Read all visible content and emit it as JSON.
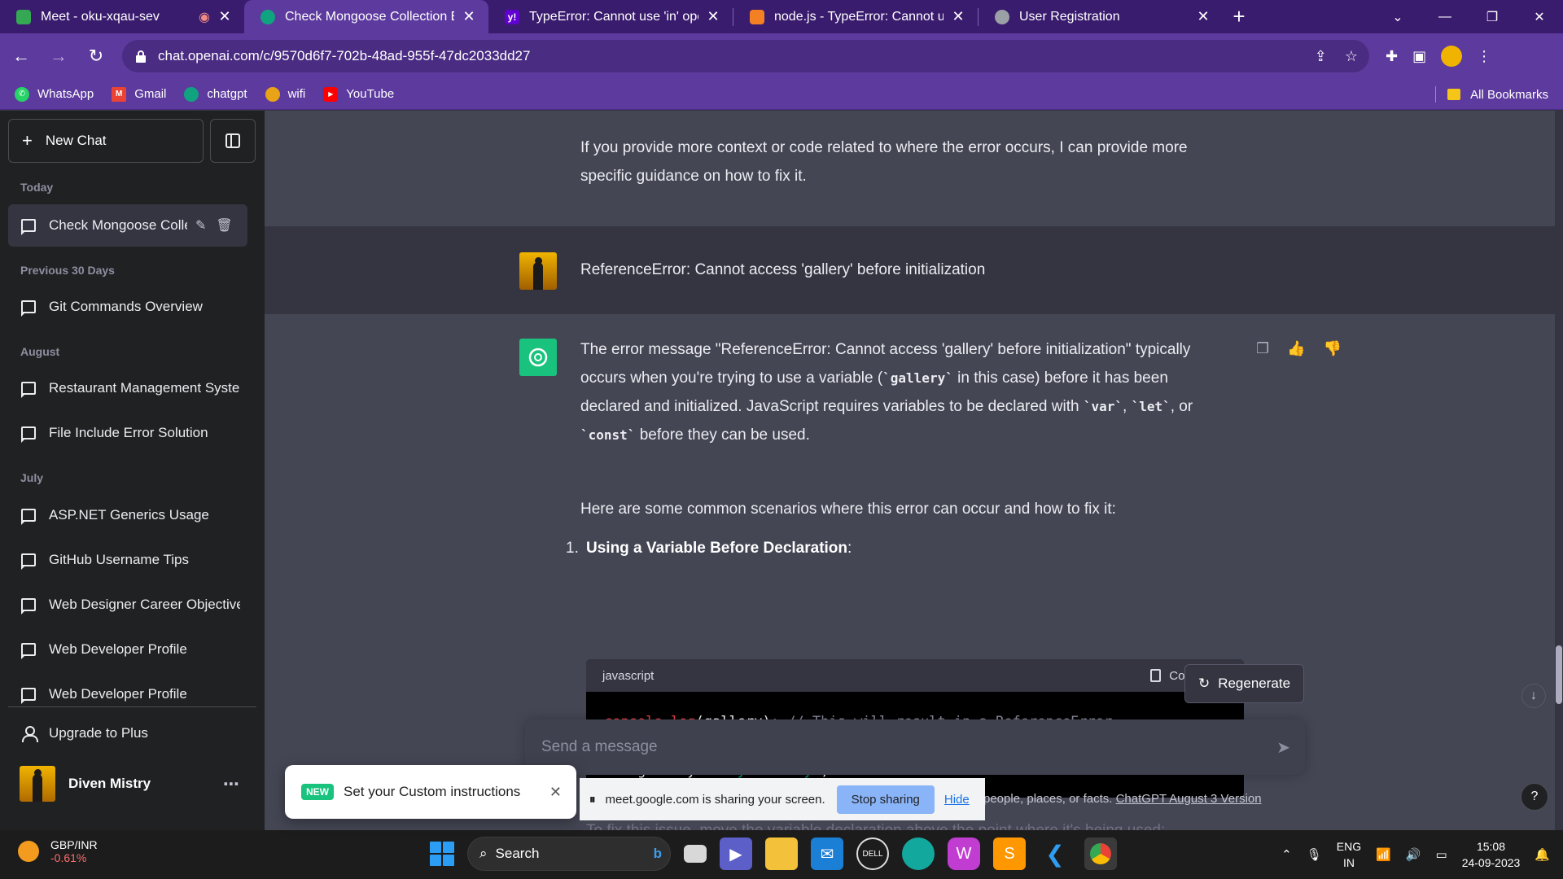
{
  "browser": {
    "tabs": [
      {
        "title": "Meet - oku-xqau-sev",
        "favicon_color": "#34a853",
        "active": false
      },
      {
        "title": "Check Mongoose Collection Exist",
        "favicon_color": "#10a37f",
        "active": true
      },
      {
        "title": "TypeError: Cannot use 'in' operat",
        "favicon_color": "#6001d2",
        "active": false
      },
      {
        "title": "node.js - TypeError: Cannot use 'i",
        "favicon_color": "#f48024",
        "active": false
      },
      {
        "title": "User Registration",
        "favicon_color": "#9aa0a6",
        "active": false
      }
    ],
    "url": "chat.openai.com/c/9570d6f7-702b-48ad-955f-47dc2033dd27",
    "bookmarks": [
      {
        "label": "WhatsApp",
        "color": "#25d366"
      },
      {
        "label": "Gmail",
        "color": "#ea4335"
      },
      {
        "label": "chatgpt",
        "color": "#10a37f"
      },
      {
        "label": "wifi",
        "color": "#e8a317"
      },
      {
        "label": "YouTube",
        "color": "#ff0000"
      }
    ],
    "all_bookmarks": "All Bookmarks"
  },
  "sidebar": {
    "new_chat": "New Chat",
    "groups": {
      "today": "Today",
      "prev30": "Previous 30 Days",
      "august": "August",
      "july": "July"
    },
    "items": [
      {
        "label": "Check Mongoose Collection Exists"
      },
      {
        "label": "Git Commands Overview"
      },
      {
        "label": "Restaurant Management System"
      },
      {
        "label": "File Include Error Solution"
      },
      {
        "label": "ASP.NET Generics Usage"
      },
      {
        "label": "GitHub Username Tips"
      },
      {
        "label": "Web Designer Career Objective"
      },
      {
        "label": "Web Developer Profile"
      },
      {
        "label": "Web Developer Profile"
      }
    ],
    "upgrade": "Upgrade to Plus",
    "user_name": "Diven Mistry"
  },
  "chat": {
    "prev_reply": "If you provide more context or code related to where the error occurs, I can provide more specific guidance on how to fix it.",
    "user_msg": "ReferenceError: Cannot access 'gallery' before initialization",
    "answer": {
      "p1_a": "The error message \"ReferenceError: Cannot access 'gallery' before initialization\" typically occurs when you're trying to use a variable (",
      "p1_code1": "`gallery`",
      "p1_b": " in this case) before it has been declared and initialized. JavaScript requires variables to be declared with ",
      "p1_code2": "`var`",
      "p1_c": ", ",
      "p1_code3": "`let`",
      "p1_d": ", or ",
      "p1_code4": "`const`",
      "p1_e": " before they can be used.",
      "p2": "Here are some common scenarios where this error can occur and how to fix it:",
      "list_num": "1.",
      "list_title": "Using a Variable Before Declaration",
      "list_colon": ":",
      "code_lang": "javascript",
      "copy_code": "Copy code",
      "code": {
        "l1_fn": "console.log",
        "l1_arg": "(gallery); ",
        "l1_cmt": "// This will result in a ReferenceError",
        "l2_kw": "let",
        "l2_mid": " gallery = ",
        "l2_str": "\"My Gallery\"",
        "l2_end": ";"
      },
      "faded": "To fix this issue, move the variable declaration above the point where it's being used:"
    },
    "regenerate": "Regenerate",
    "input_placeholder": "Send a message",
    "footer_text": "people, places, or facts. ",
    "footer_link": "ChatGPT August 3 Version"
  },
  "overlays": {
    "new_badge": "NEW",
    "custom_instructions": "Set your Custom instructions",
    "share_msg": "meet.google.com is sharing your screen.",
    "stop_sharing": "Stop sharing",
    "hide": "Hide"
  },
  "taskbar": {
    "ticker_name": "GBP/INR",
    "ticker_change": "-0.61%",
    "search": "Search",
    "lang_top": "ENG",
    "lang_bottom": "IN",
    "time": "15:08",
    "date": "24-09-2023"
  }
}
